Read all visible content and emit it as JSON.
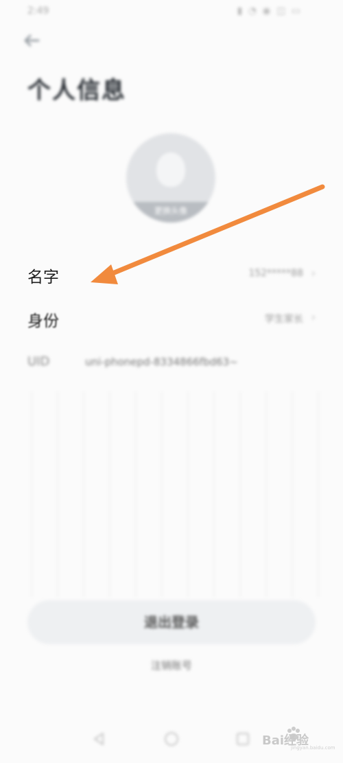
{
  "status_bar": {
    "left_text": "2:49",
    "right_text": ""
  },
  "header": {
    "title": "个人信息"
  },
  "avatar": {
    "change_label": "更换头像"
  },
  "rows": [
    {
      "label": "名字",
      "value": "152*****88",
      "chevron": "›"
    },
    {
      "label": "身份",
      "value": "学生家长",
      "chevron": "›"
    }
  ],
  "uid": {
    "label": "UID",
    "value": "uni-phonepd-8334866fbd63~"
  },
  "actions": {
    "primary_label": "退出登录",
    "secondary_label": "注销账号"
  },
  "watermark": {
    "text": "Bai经验",
    "subtext": "jingyan.baidu.com"
  },
  "colors": {
    "arrow": "#f18a3d",
    "background": "#fbfbfb",
    "title": "#2a2f35"
  },
  "icons": {
    "back": "arrow-left-icon",
    "nav_back": "triangle-back-icon",
    "nav_home": "circle-home-icon",
    "nav_recent": "square-recent-icon"
  }
}
